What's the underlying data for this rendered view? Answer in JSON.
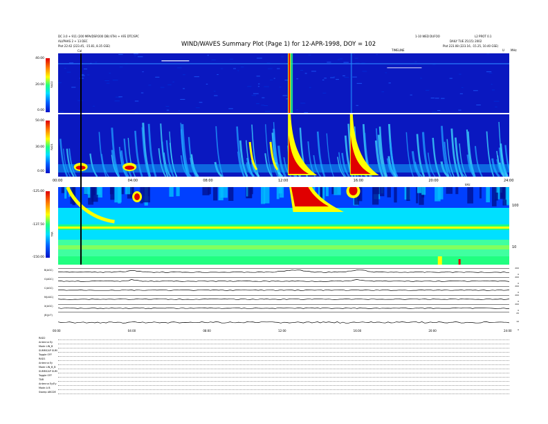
{
  "header": {
    "left_line1": "DC 3.0 + 911 (200 MPA/DSP/200 DB) 6TH) + AFE DTC/SPC",
    "left_line2": "ALI/PHAS 2 + 13 DEC",
    "left_line3": "Plot 22:42 (223.45, -15.81, 8.35 GSE)",
    "right_line1": "1-10 WED DUFOO",
    "right_line2": "DAILY TUE 25(15) 2002",
    "right_line3": "Plot 223.08 (223.16, -15.25, 10.40 GSE)",
    "right_corner": "L2 PROT 0.1",
    "title": "WIND/WAVES Summary Plot (Page 1) for 12-APR-1998, DOY = 102",
    "cal_marker": "Cal",
    "timeline_label": "TIMELINE",
    "top_right_mark": "MHz",
    "u_label": "U"
  },
  "colors": {
    "background_panel": "#0a18c0",
    "burst": "#e00000",
    "band_yellow": "#ffff00",
    "band_green": "#20ff80",
    "cyan": "#00e0ff"
  },
  "chart_data": [
    {
      "type": "heatmap",
      "name": "RAD2",
      "ylabel": "RAD2",
      "colorbar_ticks": [
        "40.00",
        "20.00",
        "0.00"
      ],
      "bursts": [
        {
          "time": 12.3,
          "intensity": 1.0
        },
        {
          "time": 15.6,
          "intensity": 0.2
        }
      ]
    },
    {
      "type": "heatmap",
      "name": "RAD1",
      "ylabel": "RAD1",
      "colorbar_ticks": [
        "50.00",
        "30.00",
        "0.00"
      ],
      "xticks": [
        "00:00",
        "04:00",
        "08:00",
        "12:00",
        "16:00",
        "20:00",
        "24:00"
      ],
      "bursts": [
        {
          "time": 12.3,
          "intensity": 1.0
        },
        {
          "time": 15.6,
          "intensity": 0.9
        },
        {
          "time": 3.8,
          "intensity": 0.6
        },
        {
          "time": 1.2,
          "intensity": 0.5
        },
        {
          "time": 10.2,
          "intensity": 0.4
        },
        {
          "time": 11.3,
          "intensity": 0.3
        }
      ]
    },
    {
      "type": "heatmap",
      "name": "TNR",
      "ylabel": "TNR",
      "colorbar_ticks": [
        "-125.00",
        "-137.50",
        "-150.00"
      ],
      "right_ticks": [
        "100",
        "10"
      ],
      "right_label": "kHz",
      "xlim": [
        0,
        24
      ]
    }
  ],
  "timeseries": [
    {
      "label": "B(AGC)",
      "scale": [
        "200",
        "0"
      ]
    },
    {
      "label": "G(AGC)",
      "scale": [
        "200",
        "0"
      ]
    },
    {
      "label": "C(AGC)",
      "scale": [
        "200",
        "0"
      ]
    },
    {
      "label": "M(AGC)",
      "scale": [
        "200",
        "0"
      ]
    },
    {
      "label": "X(AGC)",
      "scale": [
        "200",
        "0"
      ]
    },
    {
      "label": "|B|(nT)",
      "scale": [
        "20",
        "10",
        "0"
      ]
    }
  ],
  "bottom_xticks": [
    "00:00",
    "04:00",
    "08:00",
    "12:00",
    "16:00",
    "20:00",
    "24:00"
  ],
  "settings": [
    "RAD2",
    "Antenna Ey",
    "Mode LIN_B",
    "SUMMCAP SUM",
    "Toggle OFF",
    "RAD1",
    "Antenna Ey",
    "Mode LIN_B_B",
    "SUMMCAP SUM",
    "Toggle OFF",
    "TNR",
    "Antenna Ey/Ey",
    "Mode A B",
    "Sweep ABCDE"
  ]
}
